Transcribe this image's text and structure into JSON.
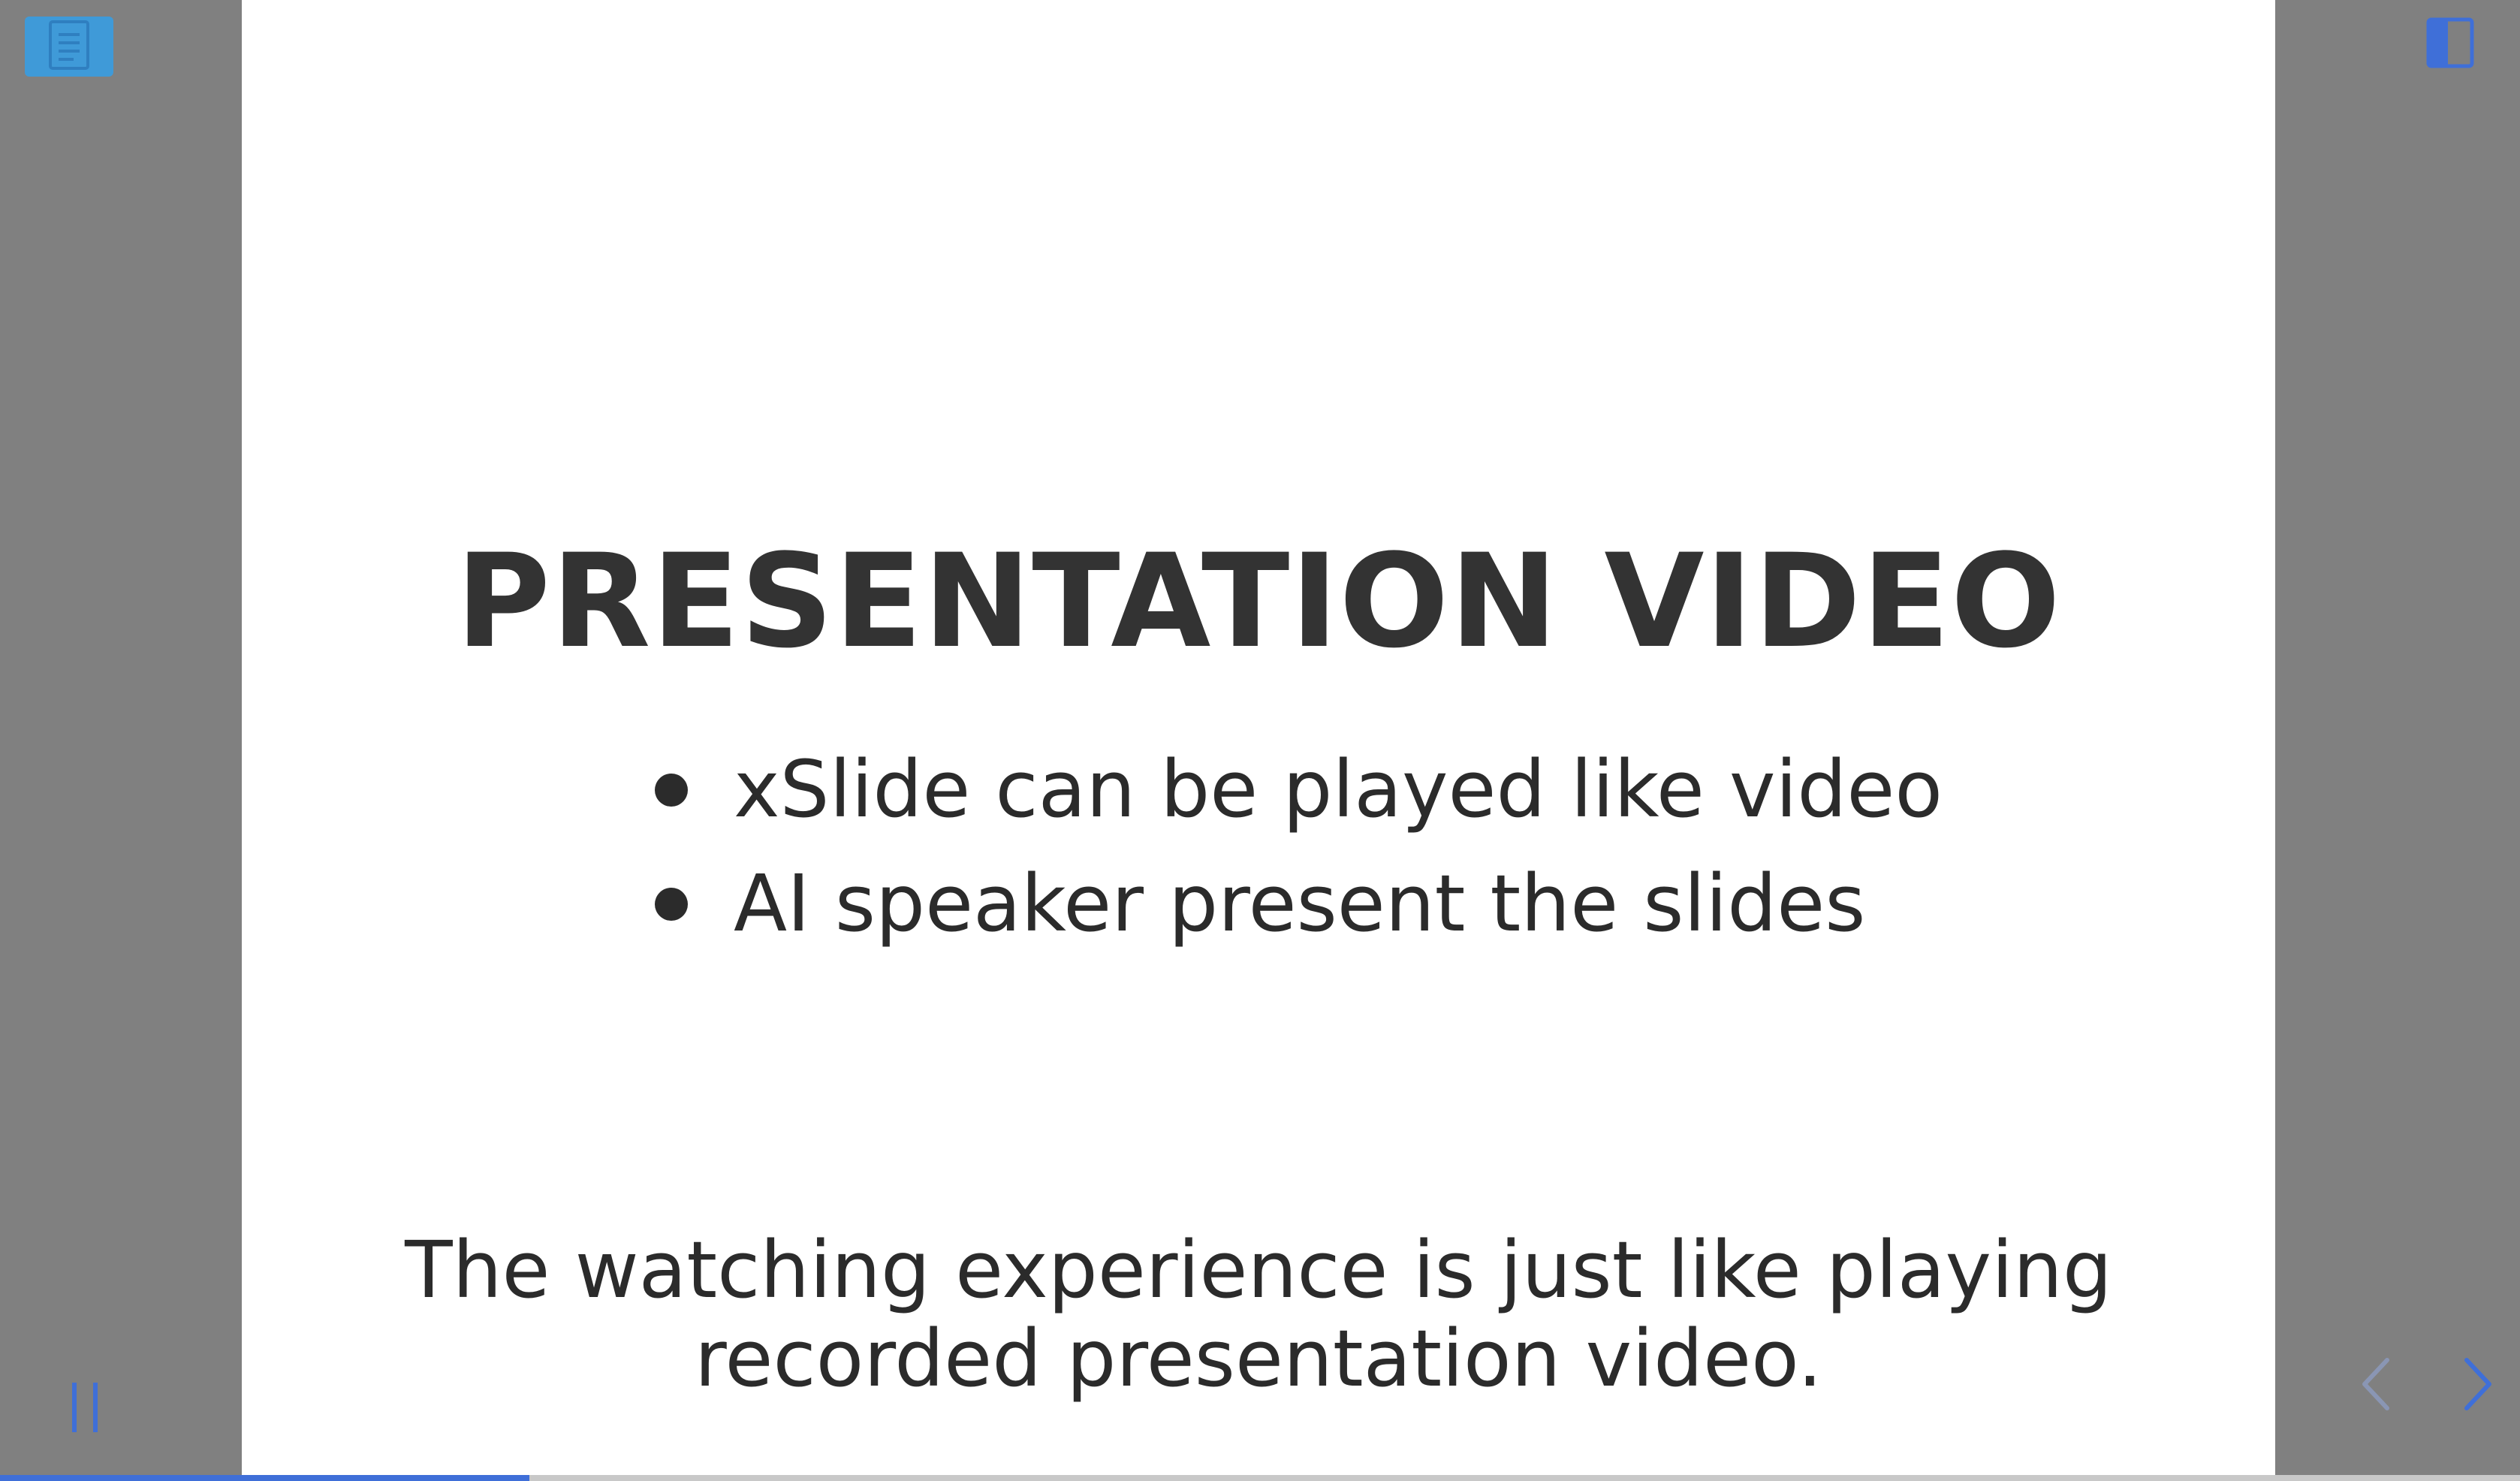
{
  "slide": {
    "title": "PRESENTATION VIDEO",
    "bullets": [
      "xSlide can be played like video",
      "AI speaker present the slides"
    ],
    "caption": "The watching experience is just like playing recorded presentation video."
  },
  "player": {
    "progress_fraction": 0.21,
    "accent_color": "#3f6fd8",
    "notes_button_color": "#3f9ad8",
    "icons": {
      "notes": "notes-document-icon",
      "sidebar": "sidebar-toggle-icon",
      "pause": "pause-icon",
      "previous": "chevron-left-icon",
      "next": "chevron-right-icon"
    }
  }
}
